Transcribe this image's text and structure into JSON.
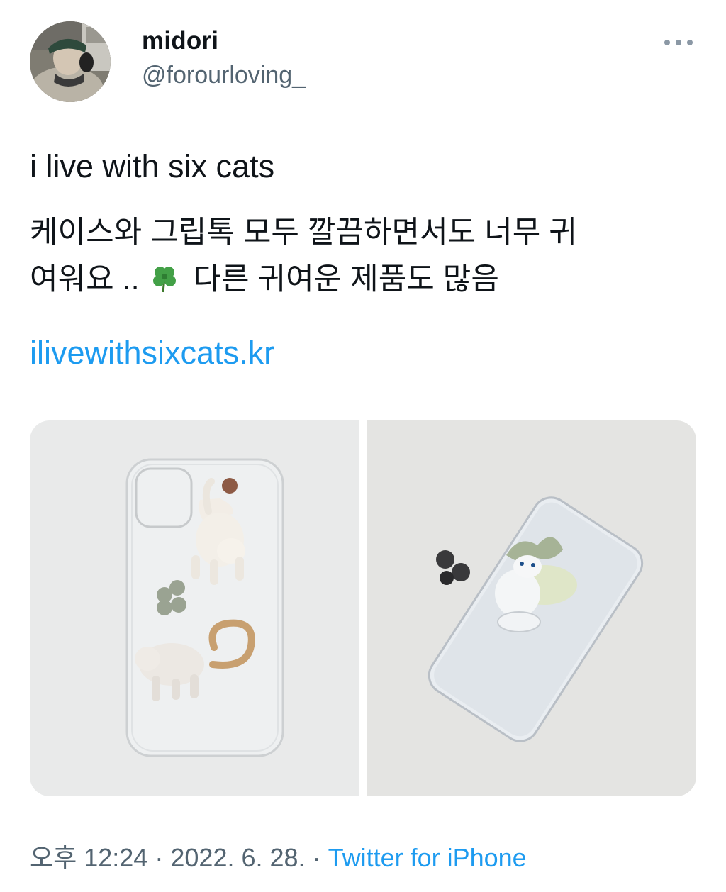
{
  "tweet": {
    "author": {
      "display_name": "midori",
      "handle": "@forourloving_",
      "avatar": "avatar-photo"
    },
    "more_icon": "more-horizontal-icon",
    "text_line1": "i live with six cats",
    "text_line2_a": "케이스와 그립톡 모두 깔끔하면서도 너무 귀",
    "text_line2_b": "여워요 ..",
    "emoji": "four-leaf-clover-icon",
    "text_line2_c": "다른 귀여운 제품도 많음",
    "link": "ilivewithsixcats.kr",
    "media": [
      {
        "name": "clear phone case with clay cat and clover decorations"
      },
      {
        "name": "silver phone with clay cat grip holder"
      }
    ],
    "time": "오후 12:24",
    "separator": "·",
    "date": "2022. 6. 28.",
    "source": "Twitter for iPhone"
  },
  "colors": {
    "text": "#0f1419",
    "secondary": "#536471",
    "link": "#1d9bf0"
  }
}
